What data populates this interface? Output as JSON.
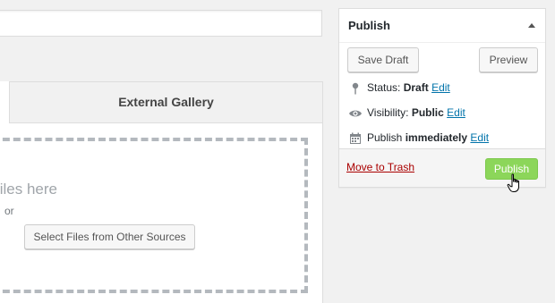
{
  "gallery": {
    "external_tab_label": "External Gallery",
    "drop_text": "files here",
    "or_text": "or",
    "select_button_label": "Select Files from Other Sources"
  },
  "publish": {
    "title": "Publish",
    "save_draft_label": "Save Draft",
    "preview_label": "Preview",
    "status_label": "Status:",
    "status_value": "Draft",
    "visibility_label": "Visibility:",
    "visibility_value": "Public",
    "schedule_label": "Publish",
    "schedule_value": "immediately",
    "edit_label": "Edit",
    "trash_label": "Move to Trash",
    "publish_button_label": "Publish"
  },
  "icons": {
    "status": "pin-icon",
    "visibility": "eye-icon",
    "schedule": "calendar-icon",
    "collapse": "triangle-up-icon",
    "cursor": "hand-pointer-icon"
  },
  "colors": {
    "link": "#0073aa",
    "trash": "#aa0000",
    "publish_button": "#8cd65a"
  }
}
